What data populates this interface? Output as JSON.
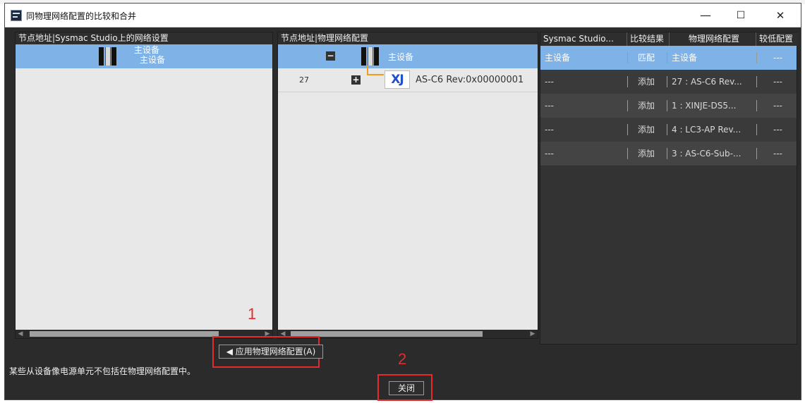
{
  "window": {
    "title": "同物理网络配置的比较和合并",
    "minimize_glyph": "—",
    "maximize_glyph": "☐",
    "close_glyph": "✕"
  },
  "left_panel": {
    "header": "节点地址|Sysmac Studio上的网络设置",
    "device_name_line1": "主设备",
    "device_name_line2": "主设备"
  },
  "middle_panel": {
    "header": "节点地址|物理网络配置",
    "rows": [
      {
        "node": "",
        "expander": "−",
        "label": "主设备",
        "icon": "master-device-icon"
      },
      {
        "node": "27",
        "expander": "+",
        "label": "AS-C6 Rev:0x00000001",
        "icon": "xj-logo-icon",
        "logo_text": "XJ"
      }
    ]
  },
  "compare_table": {
    "columns": [
      "Sysmac Studio...",
      "比较结果",
      "物理网络配置",
      "较低配置"
    ],
    "rows": [
      {
        "sysmac": "主设备",
        "result": "匹配",
        "physical": "主设备",
        "lower": "---"
      },
      {
        "sysmac": "---",
        "result": "添加",
        "physical": "27 : AS-C6 Rev...",
        "lower": "---"
      },
      {
        "sysmac": "---",
        "result": "添加",
        "physical": "1 : XINJE-DS5...",
        "lower": "---"
      },
      {
        "sysmac": "---",
        "result": "添加",
        "physical": "4 : LC3-AP Rev...",
        "lower": "---"
      },
      {
        "sysmac": "---",
        "result": "添加",
        "physical": "3 : AS-C6-Sub-...",
        "lower": "---"
      }
    ]
  },
  "apply_button": "◀ 应用物理网络配置(A)",
  "status_message": "某些从设备像电源单元不包括在物理网络配置中。",
  "close_button": "关闭",
  "annotations": [
    "1",
    "2"
  ],
  "colors": {
    "selection": "#7fb2e6",
    "annotation_red": "#e52b2b",
    "tree_line": "#f39b1a",
    "xj_logo_blue": "#1e4fd1"
  }
}
